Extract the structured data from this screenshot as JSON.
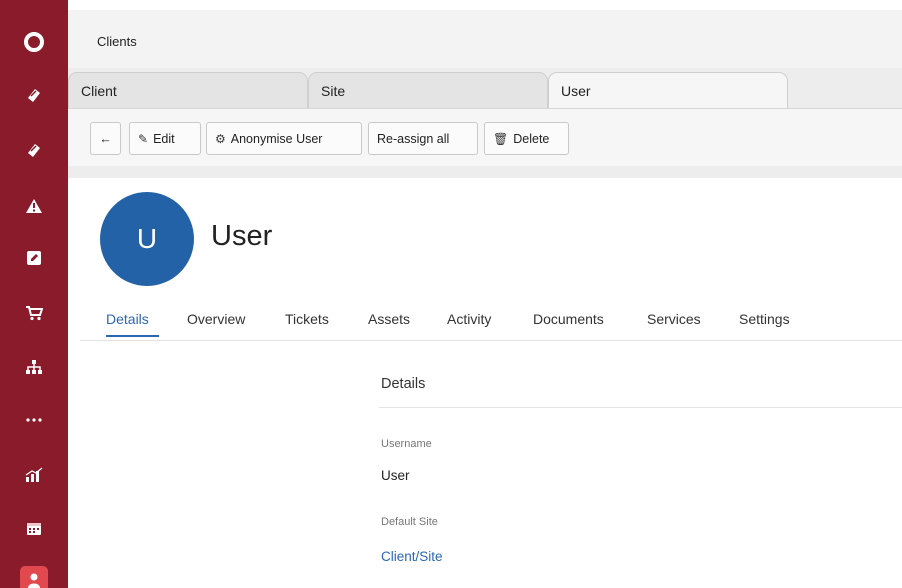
{
  "sidebar": {
    "items": [
      {
        "icon": "circle-logo-icon"
      },
      {
        "icon": "ticket-icon"
      },
      {
        "icon": "ticket-icon"
      },
      {
        "icon": "warning-icon"
      },
      {
        "icon": "edit-icon"
      },
      {
        "icon": "cart-icon"
      },
      {
        "icon": "sitemap-icon"
      },
      {
        "icon": "more-icon"
      },
      {
        "icon": "chart-icon"
      },
      {
        "icon": "calendar-icon"
      },
      {
        "icon": "user-icon",
        "active": true
      }
    ],
    "colors": {
      "background": "#8a1b2b",
      "active": "#e2494f"
    }
  },
  "breadcrumb": {
    "label": "Clients"
  },
  "tabs": [
    {
      "label": "Client"
    },
    {
      "label": "Site"
    },
    {
      "label": "User",
      "active": true
    }
  ],
  "toolbar": {
    "back_icon": "←",
    "edit_icon": "✎",
    "edit_label": "Edit",
    "anonymise_icon": "⚙",
    "anonymise_label": "Anonymise User",
    "reassign_label": "Re-assign all",
    "delete_icon": "🗑",
    "delete_label": "Delete"
  },
  "profile": {
    "avatar_letter": "U",
    "name": "User",
    "avatar_color": "#2462a8"
  },
  "subtabs": [
    {
      "label": "Details",
      "active": true
    },
    {
      "label": "Overview"
    },
    {
      "label": "Tickets"
    },
    {
      "label": "Assets"
    },
    {
      "label": "Activity"
    },
    {
      "label": "Documents"
    },
    {
      "label": "Services"
    },
    {
      "label": "Settings"
    }
  ],
  "details": {
    "section_title": "Details",
    "username_label": "Username",
    "username_value": "User",
    "default_site_label": "Default Site",
    "default_site_value": "Client/Site"
  },
  "accent_color": "#2b67b1"
}
